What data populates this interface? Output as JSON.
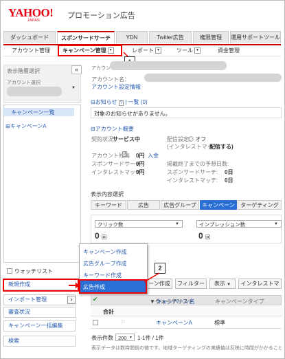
{
  "header": {
    "logo": "YAHOO!",
    "logo_sub": "JAPAN",
    "brand": "プロモーション広告"
  },
  "tabs": [
    "ダッシュボード",
    "スポンサードサーチ",
    "YDN",
    "Twitter広告",
    "権限管理",
    "運用サポートツール"
  ],
  "subnav": {
    "account": "アカウント管理",
    "campaign": "キャンペーン管理",
    "report": "レポート",
    "tool": "ツール",
    "budget": "資金管理"
  },
  "callouts": {
    "one": "1",
    "two": "2"
  },
  "left": {
    "hierarchy_label": "表示階層選択",
    "account_select": "アカウント選択",
    "collapse": "«",
    "tree_list": "キャンペーン一覧",
    "tree_campaign": "キャンペーンA",
    "watchlist": "ウォッチリスト",
    "menu": [
      "新規作成",
      "インポート管理",
      "審査状況",
      "キャンペーン一括編集",
      "検索"
    ],
    "import_arrow": "›"
  },
  "main": {
    "account_name_label": "アカウント名",
    "account_name_label2": "アカウント名：",
    "account_settings": "アカウント設定情報",
    "notice_title": "お知らせ",
    "notice_help": "?",
    "notice_list": "一覧 (0)",
    "notice_empty": "対象のお知らせがありません。",
    "overview_title": "アカウント概要",
    "contract_label": "契約状況:",
    "contract_value": "サービス中",
    "delivery_label": "配信設定:",
    "delivery_value": "◎ オフ",
    "interest_match_label": "(インタレストマッチ:",
    "interest_match_value": "配信する)",
    "balance_label": "アカウント残高",
    "balance_value": "0円",
    "deposit": "入金",
    "ss_label": "スポンサードサーチ:",
    "ss_value": "0円",
    "im_label": "インタレストマッチ:",
    "im_value": "0円",
    "est_label": "掲載終了までの予想日数:",
    "est_ss_label": "スポンサードサーチ:",
    "est_ss_value": "0日",
    "est_im_label": "インタレストマッチ:",
    "est_im_value": "0日",
    "display_select": "表示内容選択",
    "content_tabs": [
      "キーワード",
      "広告",
      "広告グループ",
      "キャンペーン",
      "ターゲティング"
    ],
    "metric1": "クリック数",
    "metric1_value": "0",
    "metric1_unit": "回",
    "metric2": "インプレッション数",
    "metric2_value": "0",
    "metric2_unit": "回"
  },
  "popup": [
    "キャンペーン作成",
    "広告グループ作成",
    "キーワード作成",
    "広告作成"
  ],
  "toolbar": {
    "create_tail": "ーン作成",
    "filter": "フィルター",
    "display": "表示",
    "interest": "インタレストマッ"
  },
  "table": {
    "headers": [
      "ウォッチリスト",
      "キャンペーン名",
      "キャンペーンタイプ"
    ],
    "total_label": "合計",
    "rows": [
      {
        "name": "キャンペーンA",
        "type": "標準"
      }
    ],
    "page_size_label": "表示件数",
    "page_size": "200",
    "range": "1-1件 / 1件",
    "footnote": "表示データは数時間前の値です。地域ターゲティングの実績値は反映に時間がかかることがあります。"
  },
  "colors": {
    "red": "#e00000",
    "blue": "#2a6fd6",
    "link": "#2a5db0"
  }
}
